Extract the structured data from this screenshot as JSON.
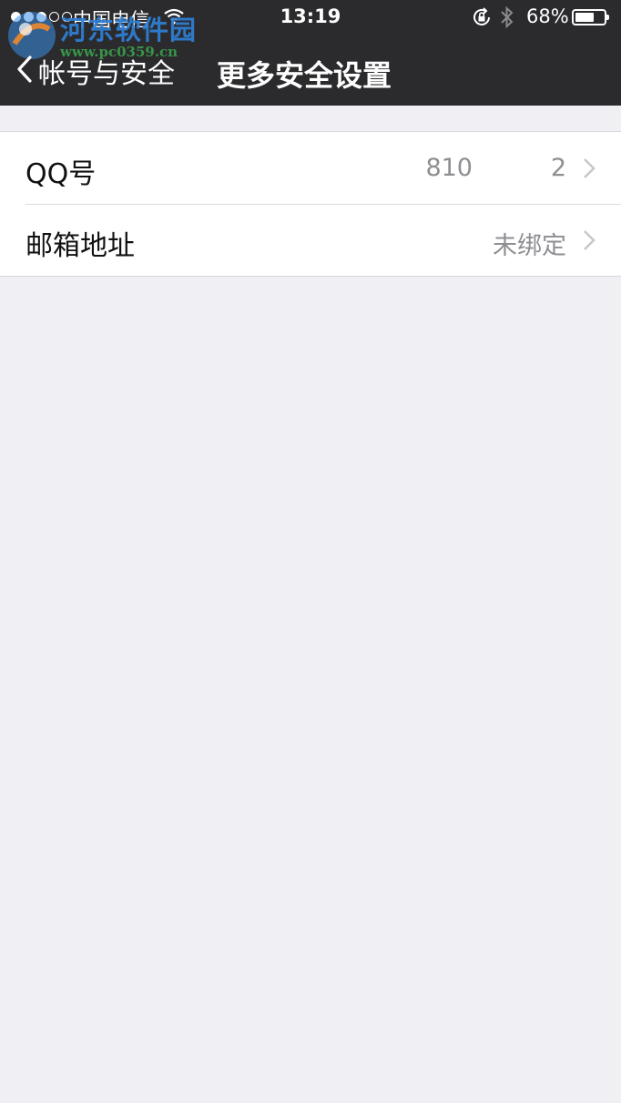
{
  "status_bar": {
    "carrier": "中国电信",
    "time": "13:19",
    "battery_percent": "68%",
    "battery_level": 0.68,
    "signal_bars": 3
  },
  "watermark": {
    "title": "河东软件园",
    "url": "www.pc0359.cn"
  },
  "nav": {
    "back_label": "帐号与安全",
    "title": "更多安全设置"
  },
  "rows": [
    {
      "label": "QQ号",
      "value": "810          2"
    },
    {
      "label": "邮箱地址",
      "value": "未绑定"
    }
  ],
  "colors": {
    "nav_background": "#2b2b2e",
    "page_background": "#efeff4",
    "value_text": "#8e8e93",
    "watermark_blue": "#2f7fd6",
    "watermark_green": "#3aa04a"
  },
  "icons": [
    "signal-dots-icon",
    "wifi-icon",
    "rotation-lock-icon",
    "bluetooth-icon",
    "battery-icon",
    "back-chevron-icon",
    "chevron-right-icon"
  ]
}
